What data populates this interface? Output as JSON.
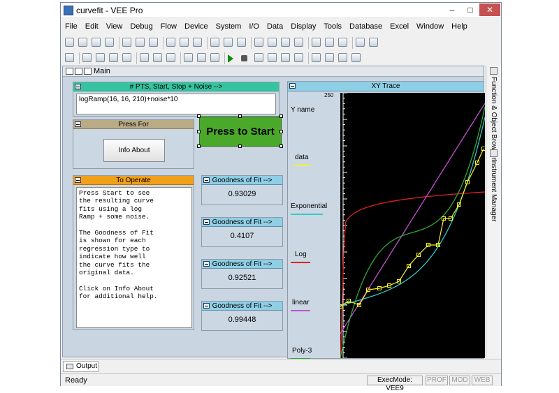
{
  "window": {
    "title": "curvefit - VEE Pro",
    "min": "–",
    "max": "□",
    "close": "✕"
  },
  "menu": [
    "File",
    "Edit",
    "View",
    "Debug",
    "Flow",
    "Device",
    "System",
    "I/O",
    "Data",
    "Display",
    "Tools",
    "Database",
    "Excel",
    "Window",
    "Help"
  ],
  "toolbar1_icons": [
    "new-icon",
    "open-icon",
    "save-icon",
    "print-icon",
    "cut-icon",
    "copy-icon",
    "paste-icon",
    "undo-icon",
    "redo-icon",
    "delete-icon",
    "find-icon",
    "settings-icon",
    "zoom-icon",
    "function-icon",
    "chart-icon",
    "tile-icon",
    "grid-icon",
    "align-icon",
    "properties-icon",
    "layout-icon",
    "globe-icon",
    "network-icon"
  ],
  "toolbar2_icons": [
    "sum-icon",
    "object-icon",
    "panel-icon",
    "view-icon",
    "detail-icon",
    "graph-icon",
    "bar-icon",
    "trend-icon",
    "link-icon",
    "cancel-icon",
    "clipboard-icon",
    "play-icon",
    "stop-icon",
    "pause-icon",
    "step-icon",
    "step-into-icon",
    "step-out-icon",
    "lock-icon",
    "monitor-icon",
    "instrument-icon",
    "config-icon"
  ],
  "main_window": {
    "title": "Main"
  },
  "pts_object": {
    "title": "# PTS, Start, Stop + Noise  -->",
    "value": "logRamp(16, 16, 210)+noise*10",
    "color": "#35c3a0"
  },
  "press_for": {
    "title": "Press For",
    "button": "Info About",
    "color": "#b8ab86"
  },
  "start_button": {
    "label": "Press to Start",
    "color": "#4aa82a"
  },
  "to_operate": {
    "title": "To Operate",
    "color": "#f2a01a",
    "lines": [
      "Press Start to see",
      "the resulting curve",
      "fits using a log",
      "Ramp + some noise.",
      "",
      "The Goodness of Fit",
      "is shown for each",
      "regression type to",
      "indicate how well",
      "the curve fits the",
      "original data.",
      "",
      "Click on Info About",
      "for additional help."
    ]
  },
  "goodness": [
    {
      "title": "Goodness of Fit -->",
      "value": "0.93029"
    },
    {
      "title": "Goodness of Fit -->",
      "value": "0.4107"
    },
    {
      "title": "Goodness of Fit -->",
      "value": "0.92521"
    },
    {
      "title": "Goodness of Fit -->",
      "value": "0.99448"
    }
  ],
  "xy_trace": {
    "title": "XY Trace",
    "y_name": "Y name",
    "y_max": "250",
    "legend": [
      {
        "name": "data",
        "color": "#f5f226"
      },
      {
        "name": "Exponential",
        "color": "#36c8c8"
      },
      {
        "name": "Log",
        "color": "#e0231f"
      },
      {
        "name": "linear",
        "color": "#c24fd1"
      },
      {
        "name": "Poly-3",
        "color": "#2ea83a"
      }
    ]
  },
  "right_strip": {
    "function_browser": "Function & Object Browser",
    "instrument_manager": "Instrument Manager"
  },
  "output_tab": {
    "label": "Output"
  },
  "status": {
    "ready": "Ready",
    "exec_mode": "ExecMode: VEE9",
    "prof": "PROF",
    "mod": "MOD",
    "web": "WEB"
  }
}
